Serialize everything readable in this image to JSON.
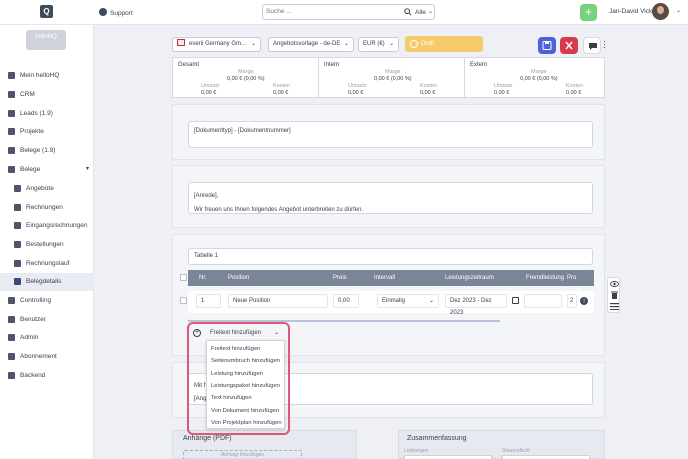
{
  "topbar": {
    "logo": "Q",
    "support": "Support",
    "search_placeholder": "Suche ...",
    "search_scope": "Alle",
    "add_label": "+",
    "user_name": "Jan-David Vick"
  },
  "sidebar": {
    "brand": "helloHQ",
    "items": [
      {
        "label": "Mein helloHQ"
      },
      {
        "label": "CRM"
      },
      {
        "label": "Leads (1.9)"
      },
      {
        "label": "Projekte"
      },
      {
        "label": "Belege (1.9)"
      },
      {
        "label": "Belege"
      },
      {
        "label": "Angebote"
      },
      {
        "label": "Rechnungen"
      },
      {
        "label": "Eingangsrechnungen"
      },
      {
        "label": "Bestellungen"
      },
      {
        "label": "Rechnungslauf"
      },
      {
        "label": "Belegdetails"
      },
      {
        "label": "Controlling"
      },
      {
        "label": "Benutzer"
      },
      {
        "label": "Admin"
      },
      {
        "label": "Abonnement"
      },
      {
        "label": "Backend"
      }
    ]
  },
  "toolbar": {
    "company": "everii Germany Gm...",
    "template": "Angebotsvorlage - de-DE",
    "currency": "EUR (€)",
    "status": "Draft"
  },
  "summary": {
    "columns": [
      {
        "title": "Gesamt",
        "marge_label": "Marge",
        "marge": "0,00 € (0,00 %)",
        "umsatz_label": "Umsatz",
        "umsatz": "0,00 €",
        "kosten_label": "Kosten",
        "kosten": "0,00 €"
      },
      {
        "title": "Intern",
        "marge_label": "Marge",
        "marge": "0,00 € (0,00 %)",
        "umsatz_label": "Umsatz",
        "umsatz": "0,00 €",
        "kosten_label": "Kosten",
        "kosten": "0,00 €"
      },
      {
        "title": "Extern",
        "marge_label": "Marge",
        "marge": "0,00 € (0,00 %)",
        "umsatz_label": "Umsatz",
        "umsatz": "0,00 €",
        "kosten_label": "Kosten",
        "kosten": "0,00 €"
      }
    ]
  },
  "document": {
    "title_field": "[Dokumenttyp] - [Dokumentnummer]",
    "salutation": "[Anrede],",
    "intro": "Wir freuen uns Ihnen folgendes Angebot unterbreiten zu dürfen.",
    "table_name": "Tabelle 1",
    "columns": [
      "Nr.",
      "Position",
      "Preis",
      "Intervall",
      "Leistungszeitraum",
      "Fremdleistung",
      "Pro"
    ],
    "row": {
      "nr": "1",
      "position": "Neue Position",
      "preis": "0,00",
      "intervall": "Einmalig",
      "zeitraum": "Dez 2023 - Dez 2023",
      "pro": "2"
    },
    "closing_1": "Mit f",
    "closing_2": "[Ang"
  },
  "add_menu": {
    "selected": "Freitext hinzufügen",
    "options": [
      "Freitext hinzufügen",
      "Seitenumbruch hinzufügen",
      "Leistung hinzufügen",
      "Leistungspaket hinzufügen",
      "Text hinzufügen",
      "Von Dokument hinzufügen",
      "Von Projektplan hinzufügen"
    ]
  },
  "bottom": {
    "attachments_title": "Anhänge (PDF)",
    "attachment_button": "Anhang hinzufügen",
    "summary_title": "Zusammenfassung",
    "field_1": "Leistungen",
    "field_2": "Steuerpflicht"
  },
  "colors": {
    "accent_blue": "#4a63d8",
    "danger": "#d63c4e",
    "draft": "#f6cb6a",
    "add_green": "#7ad17c",
    "highlight": "#e0567a"
  }
}
